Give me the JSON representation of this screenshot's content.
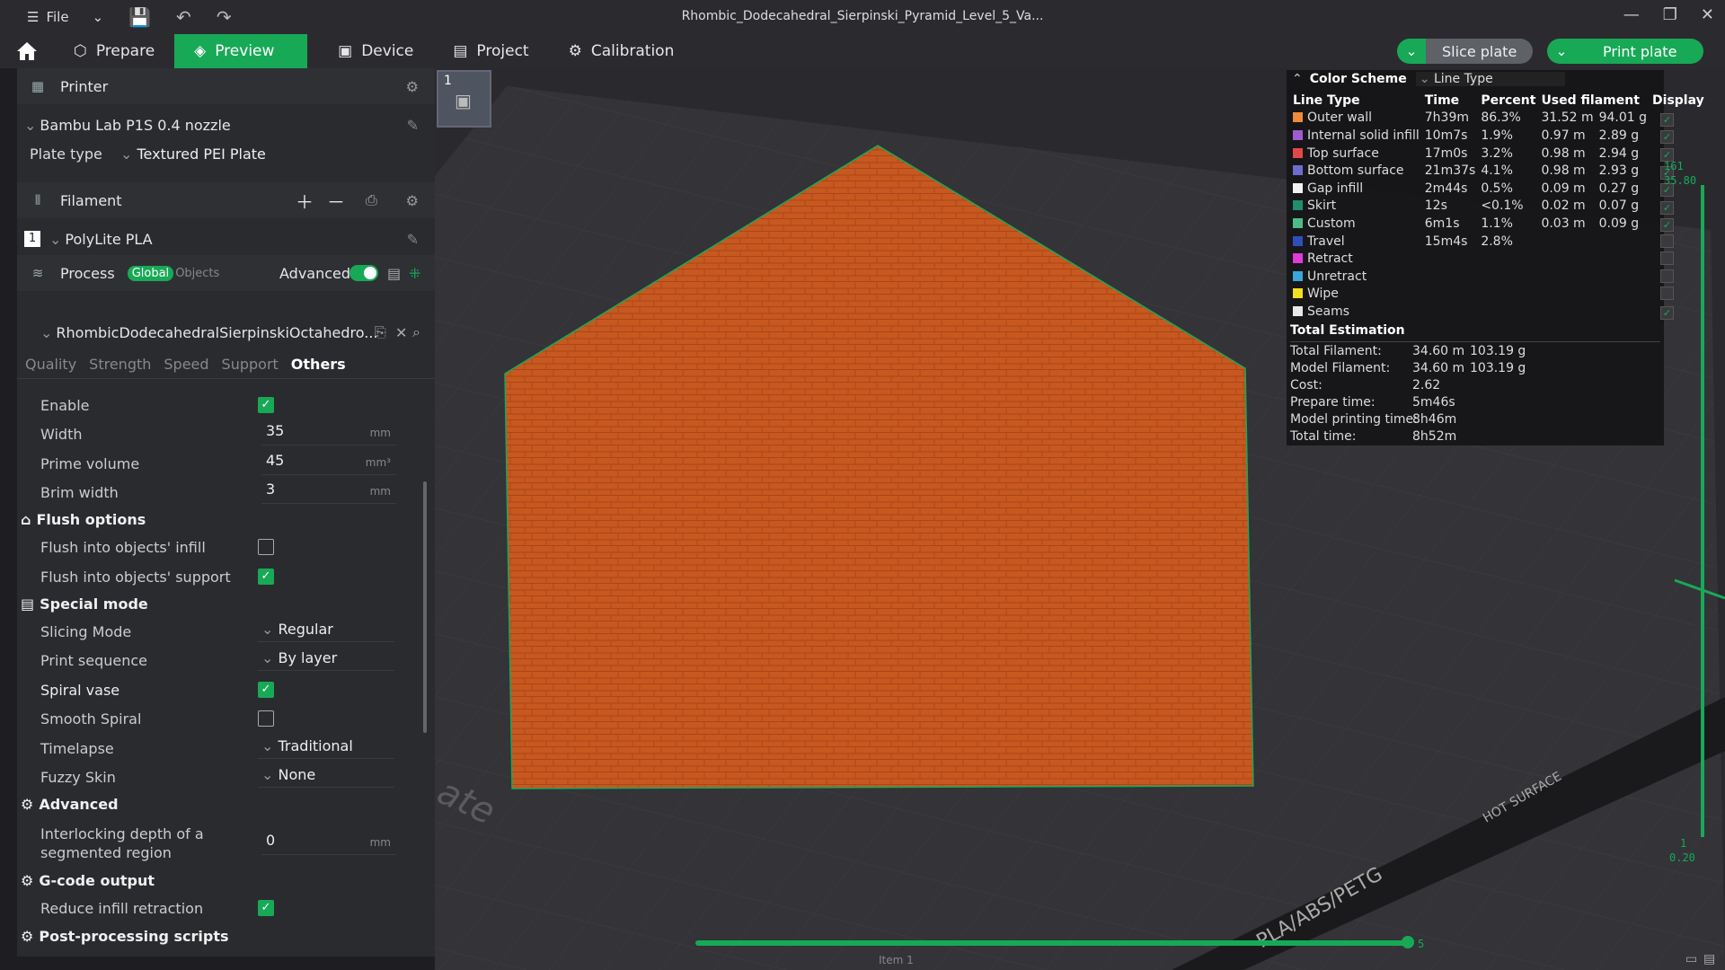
{
  "titlebar": {
    "file_label": "File",
    "title": "Rhombic_Dodecahedral_Sierpinski_Pyramid_Level_5_Va..."
  },
  "tabs": [
    {
      "label": "Prepare"
    },
    {
      "label": "Preview"
    },
    {
      "label": "Device"
    },
    {
      "label": "Project"
    },
    {
      "label": "Calibration"
    }
  ],
  "actions": {
    "slice": "Slice plate",
    "print": "Print plate"
  },
  "printer": {
    "section": "Printer",
    "name": "Bambu Lab P1S 0.4 nozzle",
    "plate_type_label": "Plate type",
    "plate_type": "Textured PEI Plate"
  },
  "filament": {
    "section": "Filament",
    "index": "1",
    "name": "PolyLite PLA"
  },
  "process": {
    "section": "Process",
    "global": "Global",
    "objects": "Objects",
    "advanced": "Advanced",
    "profile": "RhombicDodecahedralSierpinskiOctahedro...",
    "subtabs": [
      "Quality",
      "Strength",
      "Speed",
      "Support",
      "Others"
    ]
  },
  "prime_tower": {
    "enable": "Enable",
    "width_label": "Width",
    "width": "35",
    "width_unit": "mm",
    "volume_label": "Prime volume",
    "volume": "45",
    "volume_unit": "mm³",
    "brim_label": "Brim width",
    "brim": "3",
    "brim_unit": "mm"
  },
  "flush": {
    "title": "Flush options",
    "infill": "Flush into objects' infill",
    "support": "Flush into objects' support"
  },
  "special": {
    "title": "Special mode",
    "slicing_label": "Slicing Mode",
    "slicing": "Regular",
    "sequence_label": "Print sequence",
    "sequence": "By layer",
    "spiral": "Spiral vase",
    "smooth": "Smooth Spiral",
    "timelapse_label": "Timelapse",
    "timelapse": "Traditional",
    "fuzzy_label": "Fuzzy Skin",
    "fuzzy": "None"
  },
  "advanced": {
    "title": "Advanced",
    "interlock_1": "Interlocking depth of a",
    "interlock_2": "segmented region",
    "interlock": "0",
    "interlock_unit": "mm"
  },
  "gcode": {
    "title": "G-code output",
    "reduce": "Reduce infill retraction"
  },
  "post": {
    "title": "Post-processing scripts"
  },
  "plate_thumb": "1",
  "legend": {
    "title": "Color Scheme",
    "scheme": "Line Type",
    "headers": [
      "Line Type",
      "Time",
      "Percent",
      "Used filament",
      "Display"
    ],
    "rows": [
      {
        "name": "Outer wall",
        "color": "#f08a3c",
        "time": "7h39m",
        "pct": "86.3%",
        "len": "31.52 m",
        "wt": "94.01 g",
        "on": true
      },
      {
        "name": "Internal solid infill",
        "color": "#a05bd0",
        "time": "10m7s",
        "pct": "1.9%",
        "len": "0.97 m",
        "wt": "2.89 g",
        "on": true
      },
      {
        "name": "Top surface",
        "color": "#e34848",
        "time": "17m0s",
        "pct": "3.2%",
        "len": "0.98 m",
        "wt": "2.94 g",
        "on": true
      },
      {
        "name": "Bottom surface",
        "color": "#6c6ccf",
        "time": "21m37s",
        "pct": "4.1%",
        "len": "0.98 m",
        "wt": "2.93 g",
        "on": true
      },
      {
        "name": "Gap infill",
        "color": "#f2f2f2",
        "time": "2m44s",
        "pct": "0.5%",
        "len": "0.09 m",
        "wt": "0.27 g",
        "on": true
      },
      {
        "name": "Skirt",
        "color": "#1f8f6e",
        "time": "12s",
        "pct": "<0.1%",
        "len": "0.02 m",
        "wt": "0.07 g",
        "on": true
      },
      {
        "name": "Custom",
        "color": "#4dbb87",
        "time": "6m1s",
        "pct": "1.1%",
        "len": "0.03 m",
        "wt": "0.09 g",
        "on": true
      },
      {
        "name": "Travel",
        "color": "#2f4fb8",
        "time": "15m4s",
        "pct": "2.8%",
        "len": "",
        "wt": "",
        "on": false
      },
      {
        "name": "Retract",
        "color": "#e03ad8",
        "time": "",
        "pct": "",
        "len": "",
        "wt": "",
        "on": false
      },
      {
        "name": "Unretract",
        "color": "#3aa7d8",
        "time": "",
        "pct": "",
        "len": "",
        "wt": "",
        "on": false
      },
      {
        "name": "Wipe",
        "color": "#f0e020",
        "time": "",
        "pct": "",
        "len": "",
        "wt": "",
        "on": false
      },
      {
        "name": "Seams",
        "color": "#e8e8e8",
        "time": "",
        "pct": "",
        "len": "",
        "wt": "",
        "on": true
      }
    ],
    "estimation_title": "Total Estimation",
    "estimation": [
      {
        "k": "Total Filament:",
        "v1": "34.60 m",
        "v2": "103.19 g"
      },
      {
        "k": "Model Filament:",
        "v1": "34.60 m",
        "v2": "103.19 g"
      },
      {
        "k": "Cost:",
        "v1": "2.62",
        "v2": ""
      },
      {
        "k": "Prepare time:",
        "v1": "5m46s",
        "v2": ""
      },
      {
        "k": "Model printing time:",
        "v1": "8h46m",
        "v2": ""
      },
      {
        "k": "Total time:",
        "v1": "8h52m",
        "v2": ""
      }
    ]
  },
  "plate_text": {
    "material": "PLA/ABS/PETG",
    "hot": "HOT SURFACE",
    "brand": "ate"
  },
  "sliders": {
    "top_1": "161",
    "top_2": "35.80",
    "bottom_1": "1",
    "bottom_2": "0.20",
    "horiz_end": "5",
    "footer": "Item 1"
  },
  "model_color": "#c7581f",
  "accent": "#18a957"
}
